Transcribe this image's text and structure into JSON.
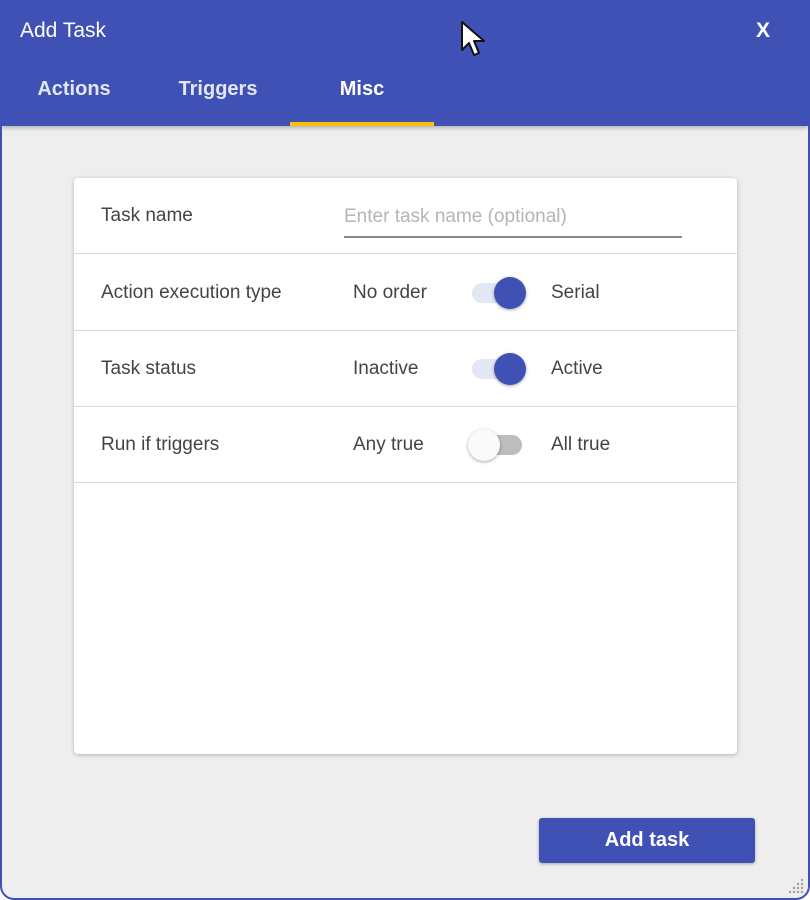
{
  "window": {
    "title": "Add Task",
    "close_label": "X"
  },
  "tabs": [
    {
      "label": "Actions",
      "active": false
    },
    {
      "label": "Triggers",
      "active": false
    },
    {
      "label": "Misc",
      "active": true
    }
  ],
  "form": {
    "task_name": {
      "label": "Task name",
      "value": "",
      "placeholder": "Enter task name (optional)"
    },
    "action_execution_type": {
      "label": "Action execution type",
      "off_label": "No order",
      "on_label": "Serial",
      "state": "on"
    },
    "task_status": {
      "label": "Task status",
      "off_label": "Inactive",
      "on_label": "Active",
      "state": "on"
    },
    "run_if_triggers": {
      "label": "Run if triggers",
      "off_label": "Any true",
      "on_label": "All true",
      "state": "off"
    }
  },
  "footer": {
    "add_button_label": "Add task"
  },
  "colors": {
    "primary": "#3f51b5",
    "tab_indicator": "#ffc107",
    "background": "#eeeeee"
  },
  "icons": {
    "cursor": "mouse-pointer-icon",
    "resize": "resize-grip-icon"
  }
}
